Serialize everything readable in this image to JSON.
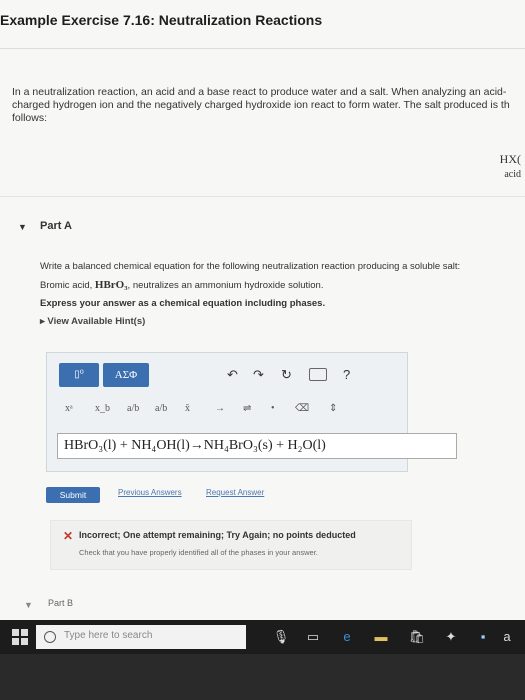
{
  "header": {
    "title": "Example Exercise 7.16: Neutralization Reactions"
  },
  "intro": {
    "line1": "In a neutralization reaction, an acid and a base react to produce water and a salt. When analyzing an acid-",
    "line2": "charged hydrogen ion and the negatively charged hydroxide ion react to form water. The salt produced is th",
    "line3": "follows:"
  },
  "equation_fragment": {
    "formula": "HX(",
    "label": "acid"
  },
  "part_a": {
    "title": "Part A",
    "instruction": "Write a balanced chemical equation for the following neutralization reaction producing a soluble salt:",
    "prompt_pre": "Bromic acid, ",
    "prompt_formula": "HBrO₃",
    "prompt_post": ", neutralizes an ammonium hydroxide solution.",
    "express": "Express your answer as a chemical equation including phases.",
    "hints": "View Available Hint(s)"
  },
  "editor": {
    "template_label": "▯⁰",
    "greek_label": "ΑΣΦ",
    "undo_icon": "undo-icon",
    "redo_icon": "redo-icon",
    "reset_icon": "reset-icon",
    "keyboard_icon": "keyboard-icon",
    "help_label": "?",
    "symbols": [
      "xᵃ",
      "x_b",
      "a/b",
      "a/b",
      "x̄",
      "→",
      "⇌",
      "•",
      "⌫",
      "⇕"
    ],
    "answer": "HBrO₃(l) + NH₄OH(l)→NH₄BrO₃(s) + H₂O(l)"
  },
  "actions": {
    "submit": "Submit",
    "previous": "Previous Answers",
    "request": "Request Answer"
  },
  "feedback": {
    "title": "Incorrect; One attempt remaining; Try Again; no points deducted",
    "message": "Check that you have properly identified all of the phases in your answer."
  },
  "part_b": {
    "title": "Part B"
  },
  "taskbar": {
    "search_placeholder": "Type here to search"
  }
}
